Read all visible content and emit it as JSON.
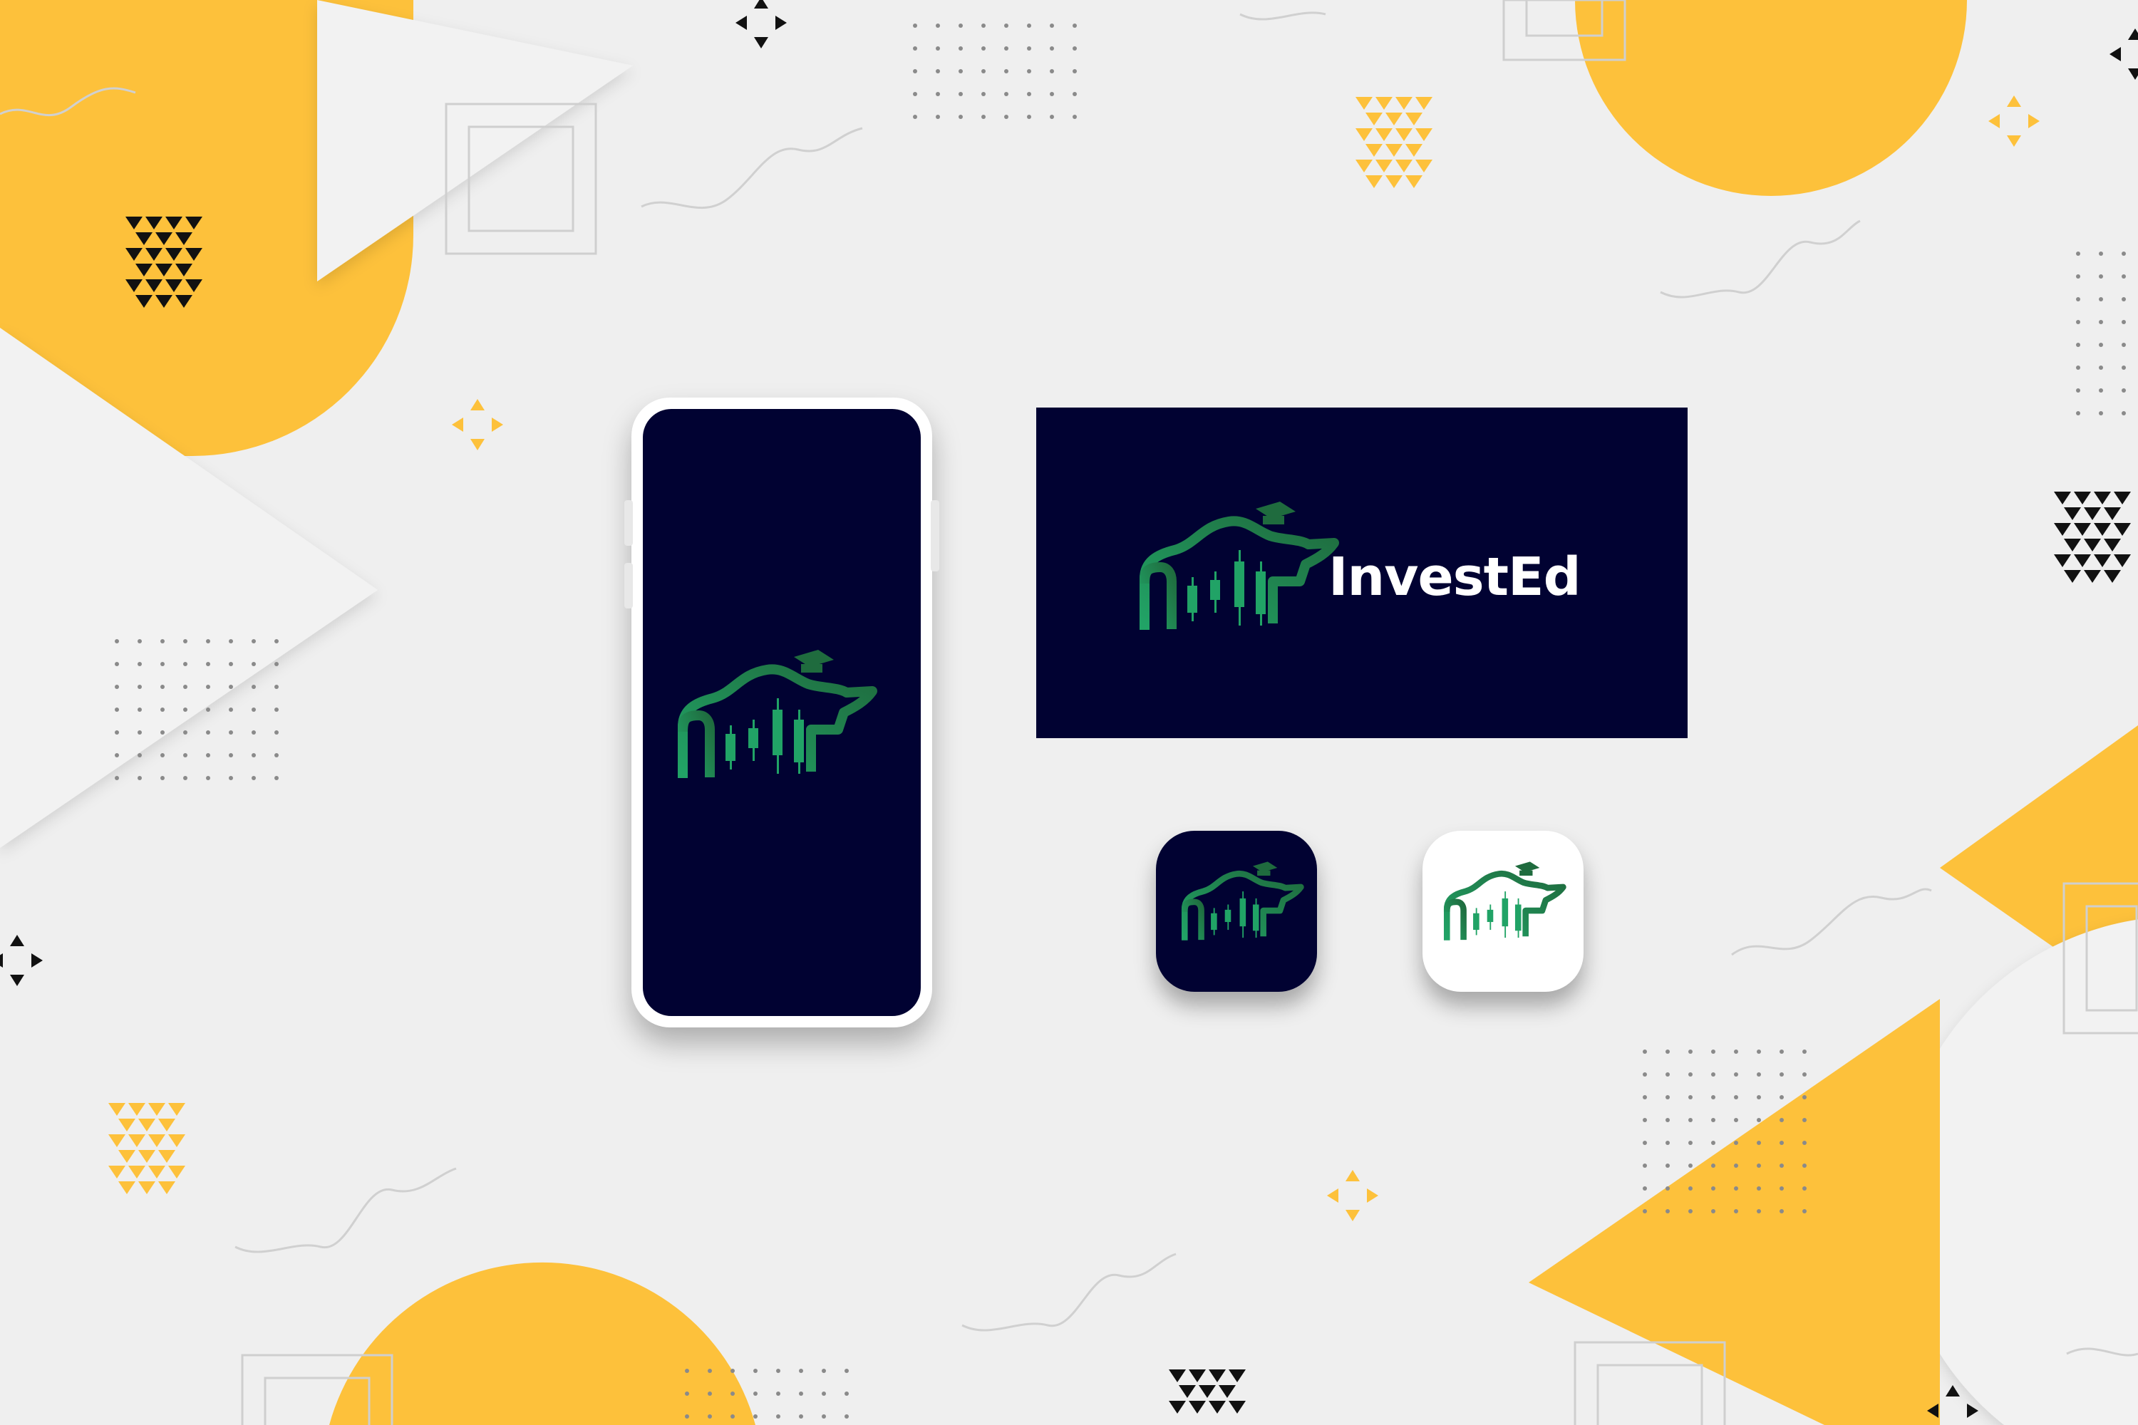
{
  "brand": {
    "name": "InvestEd"
  },
  "colors": {
    "background": "#efefef",
    "navy": "#010232",
    "yellow": "#fdc13b",
    "green_dark": "#1f6b3e",
    "green_light": "#21a366",
    "white": "#ffffff",
    "decor_black": "#111111",
    "dot_gray": "#8a8a8a"
  },
  "mockups": [
    {
      "kind": "phone-splash-screen",
      "background": "navy",
      "content": "logo-mark"
    },
    {
      "kind": "horizontal-banner",
      "background": "navy",
      "content": "logo-mark-with-wordmark"
    },
    {
      "kind": "app-icon",
      "variant": "dark",
      "content": "logo-mark"
    },
    {
      "kind": "app-icon",
      "variant": "light",
      "content": "logo-mark"
    }
  ],
  "icons": {
    "logo_mark": "bull-graduation-cap-candlestick-icon"
  }
}
